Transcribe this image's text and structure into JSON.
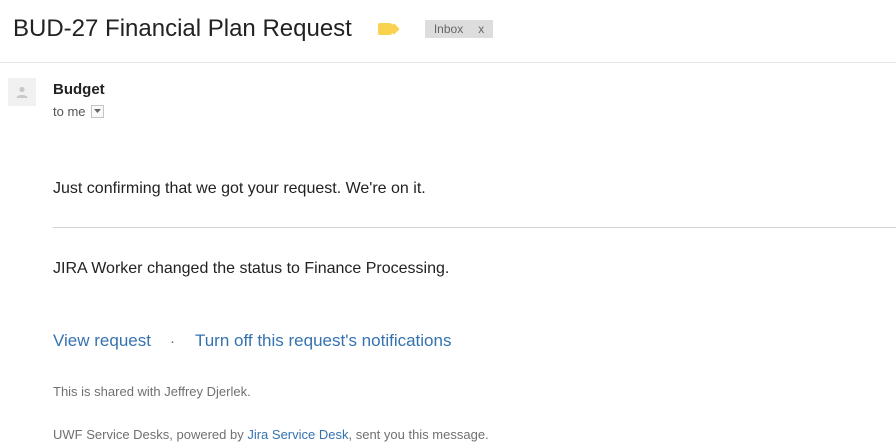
{
  "email": {
    "subject": "BUD-27 Financial Plan Request",
    "label_color": "#f9d24f",
    "inbox_chip": {
      "label": "Inbox",
      "remove_glyph": "x"
    },
    "sender": {
      "name": "Budget",
      "avatar_icon": "person-icon"
    },
    "recipient_line": "to me",
    "details_icon": "caret-down-icon"
  },
  "message": {
    "confirmation": "Just confirming that we got your request. We're on it.",
    "status_update": "JIRA Worker changed the status to Finance Processing.",
    "links": {
      "view_request": "View request",
      "separator": "·",
      "turn_off_notifications": "Turn off this request's notifications"
    },
    "shared_note": "This is shared with Jeffrey Djerlek.",
    "footer": {
      "prefix": "UWF Service Desks, powered by ",
      "link": "Jira Service Desk",
      "suffix": ", sent you this message."
    }
  },
  "colors": {
    "link": "#3572b0",
    "label_tag": "#f9d24f",
    "chip_background": "#dddddd"
  }
}
